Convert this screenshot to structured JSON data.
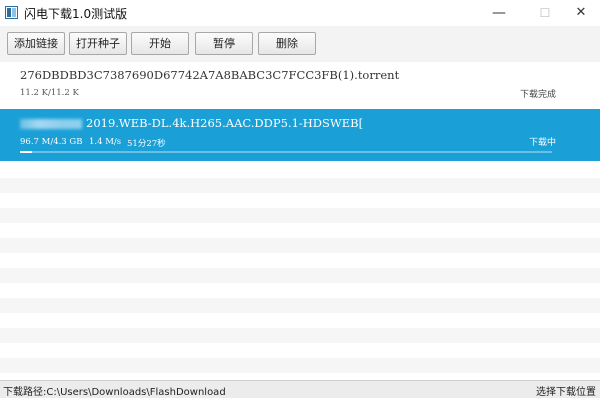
{
  "window": {
    "title": "闪电下载1.0测试版",
    "controls": {
      "minimize": "—",
      "maximize": "☐",
      "close": "✕"
    }
  },
  "toolbar": {
    "add_link": "添加链接",
    "open_torrent": "打开种子",
    "start": "开始",
    "pause": "暂停",
    "delete": "删除"
  },
  "downloads": [
    {
      "name": "276DBDBD3C7387690D67742A7A8BABC3C7FCC3FB(1).torrent",
      "size": "11.2 K/11.2 K",
      "speed": "",
      "eta": "",
      "status": "下载完成",
      "progress": 1.0,
      "selected": false
    },
    {
      "name": "2019.WEB-DL.4k.H265.AAC.DDP5.1-HDSWEB[",
      "size": "96.7 M/4.3 GB",
      "speed": "1.4 M/s",
      "eta": "51分27秒",
      "status": "下载中",
      "progress": 0.022,
      "selected": true
    }
  ],
  "statusbar": {
    "path": "下载路径:C:\\Users\\Downloads\\FlashDownload",
    "choose_location": "选择下载位置"
  },
  "colors": {
    "selection": "#1a9fd6",
    "stripe": "#f6f6f6"
  }
}
